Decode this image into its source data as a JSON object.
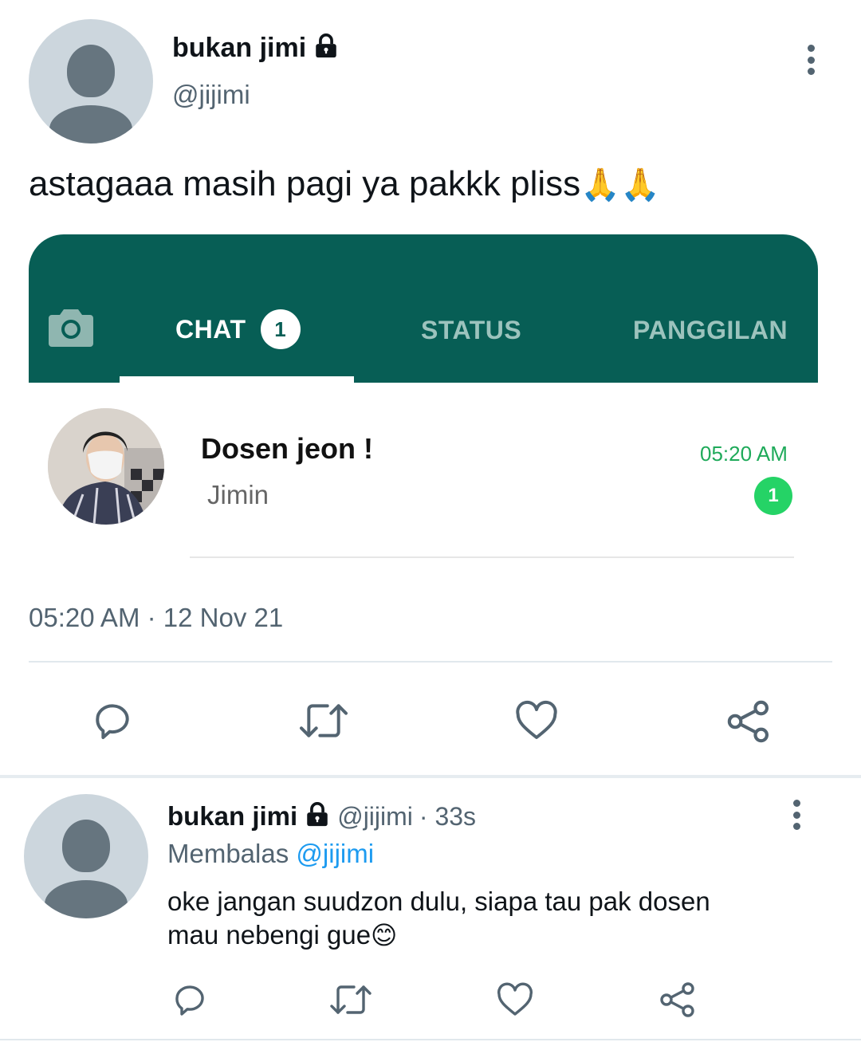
{
  "tweet": {
    "author_name": "bukan jimi",
    "author_handle": "@jijimi",
    "text": "astagaaa masih pagi ya pakkk pliss",
    "text_emoji": "🙏🙏",
    "timestamp": "05:20 AM · 12 Nov 21",
    "menu_icon": "more-vertical-icon",
    "lock_icon": "lock-icon"
  },
  "whatsapp": {
    "camera_icon": "camera-icon",
    "tabs": [
      {
        "label": "CHAT",
        "badge": "1",
        "active": true
      },
      {
        "label": "STATUS"
      },
      {
        "label": "PANGGILAN"
      }
    ],
    "chat": {
      "contact_name": "Dosen jeon !",
      "preview": "Jimin",
      "time": "05:20 AM",
      "unread": "1"
    },
    "colors": {
      "header": "#075e55",
      "accent": "#25d366",
      "time": "#1faa5a"
    }
  },
  "actions": [
    "reply-icon",
    "retweet-icon",
    "like-icon",
    "share-icon"
  ],
  "reply": {
    "author_name": "bukan jimi",
    "author_handle": "@jijimi",
    "time": "· 33s",
    "replying_prefix": "Membalas",
    "replying_to": "@jijimi",
    "text_line1": "oke jangan suudzon dulu, siapa tau pak dosen",
    "text_line2": "mau nebengi gue",
    "text_emoji": "😊"
  },
  "colors": {
    "link": "#1d9bf0",
    "muted": "#536471"
  }
}
